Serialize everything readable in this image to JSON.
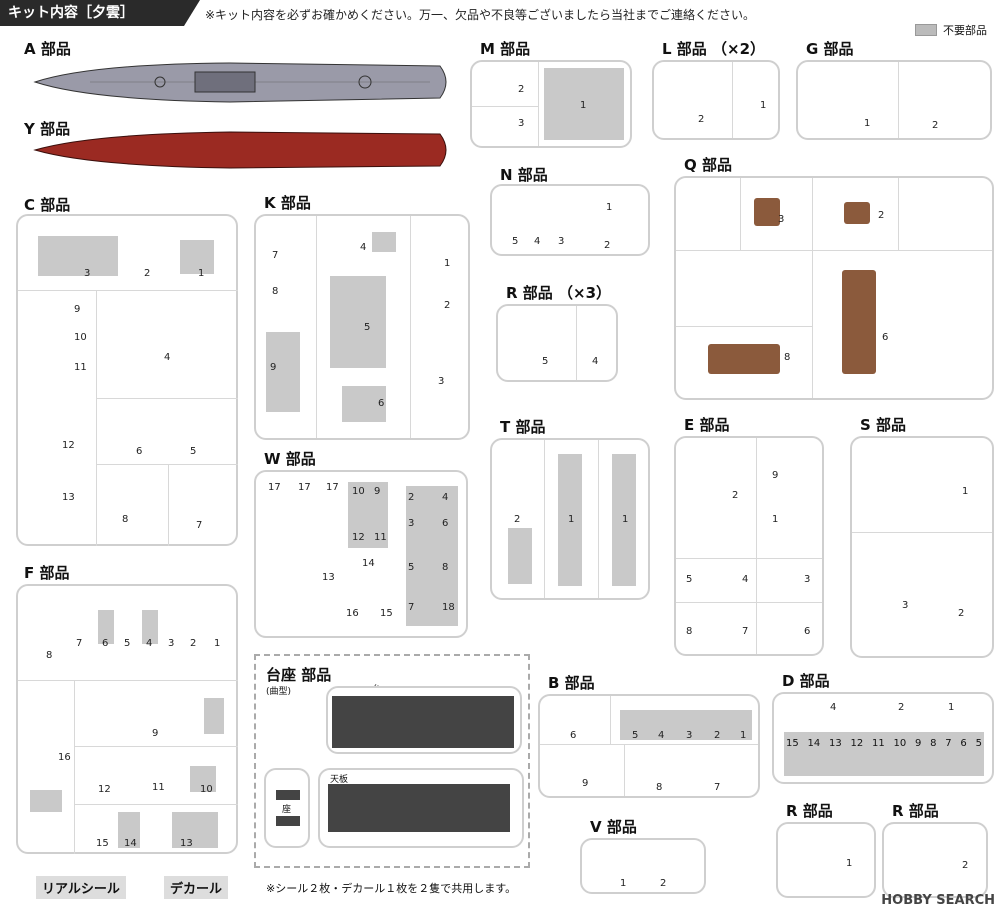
{
  "header": {
    "title": "キット内容［夕雲］",
    "notice": "※キット内容を必ずお確かめください。万一、欠品や不良等ございましたら当社までご連絡ください。"
  },
  "legend": {
    "label": "不要部品"
  },
  "groups": {
    "A": "A 部品",
    "Y": "Y 部品",
    "C": "C 部品",
    "K": "K 部品",
    "F": "F 部品",
    "W": "W 部品",
    "M": "M 部品",
    "L": "L 部品 （×2）",
    "G": "G 部品",
    "N": "N 部品",
    "Q": "Q 部品",
    "R3": "R 部品 （×3）",
    "T": "T 部品",
    "E": "E 部品",
    "S": "S 部品",
    "B": "B 部品",
    "D": "D 部品",
    "V": "V 部品",
    "R1": "R 部品",
    "R2": "R 部品",
    "base": "台座 部品",
    "base_sub": "(曲型)"
  },
  "base_labels": {
    "dai": "台",
    "za": "座",
    "tenban": "天板"
  },
  "footer": {
    "seal": "リアルシール",
    "decal": "デカール",
    "note": "※シール２枚・デカール１枚を２隻で共用します。"
  },
  "watermark": "HOBBY SEARCH",
  "colors": {
    "hull_grey": "#9a9aa8",
    "hull_red": "#9b2a22",
    "unused": "#c9c9c9",
    "brown": "#8b5a3c"
  },
  "nums": {
    "C": [
      "3",
      "2",
      "1",
      "9",
      "10",
      "11",
      "4",
      "12",
      "6",
      "5",
      "13",
      "8",
      "7"
    ],
    "K": [
      "7",
      "8",
      "4",
      "1",
      "2",
      "5",
      "9",
      "3",
      "6"
    ],
    "F": [
      "8",
      "7",
      "6",
      "5",
      "4",
      "3",
      "2",
      "1",
      "9",
      "16",
      "12",
      "11",
      "10",
      "15",
      "14",
      "13"
    ],
    "W": [
      "17",
      "17",
      "17",
      "10",
      "9",
      "12",
      "11",
      "2",
      "4",
      "3",
      "6",
      "5",
      "8",
      "7",
      "18",
      "13",
      "14",
      "16",
      "15"
    ],
    "M": [
      "2",
      "3",
      "1"
    ],
    "L": [
      "2",
      "1"
    ],
    "G": [
      "1",
      "2"
    ],
    "N": [
      "5",
      "4",
      "3",
      "1",
      "2"
    ],
    "Q": [
      "3",
      "2",
      "8",
      "6"
    ],
    "R3": [
      "5",
      "4"
    ],
    "T": [
      "2",
      "1",
      "1"
    ],
    "E": [
      "2",
      "9",
      "1",
      "5",
      "4",
      "3",
      "8",
      "7",
      "6"
    ],
    "S": [
      "1",
      "3",
      "2"
    ],
    "B": [
      "6",
      "5",
      "4",
      "3",
      "2",
      "1",
      "9",
      "8",
      "7"
    ],
    "D_top": [
      "4",
      "2",
      "1"
    ],
    "D_bot": [
      "15",
      "14",
      "13",
      "12",
      "11",
      "10",
      "9",
      "8",
      "7",
      "6",
      "5"
    ],
    "V": [
      "1",
      "2"
    ],
    "R1": [
      "1"
    ],
    "R2": [
      "2"
    ]
  }
}
